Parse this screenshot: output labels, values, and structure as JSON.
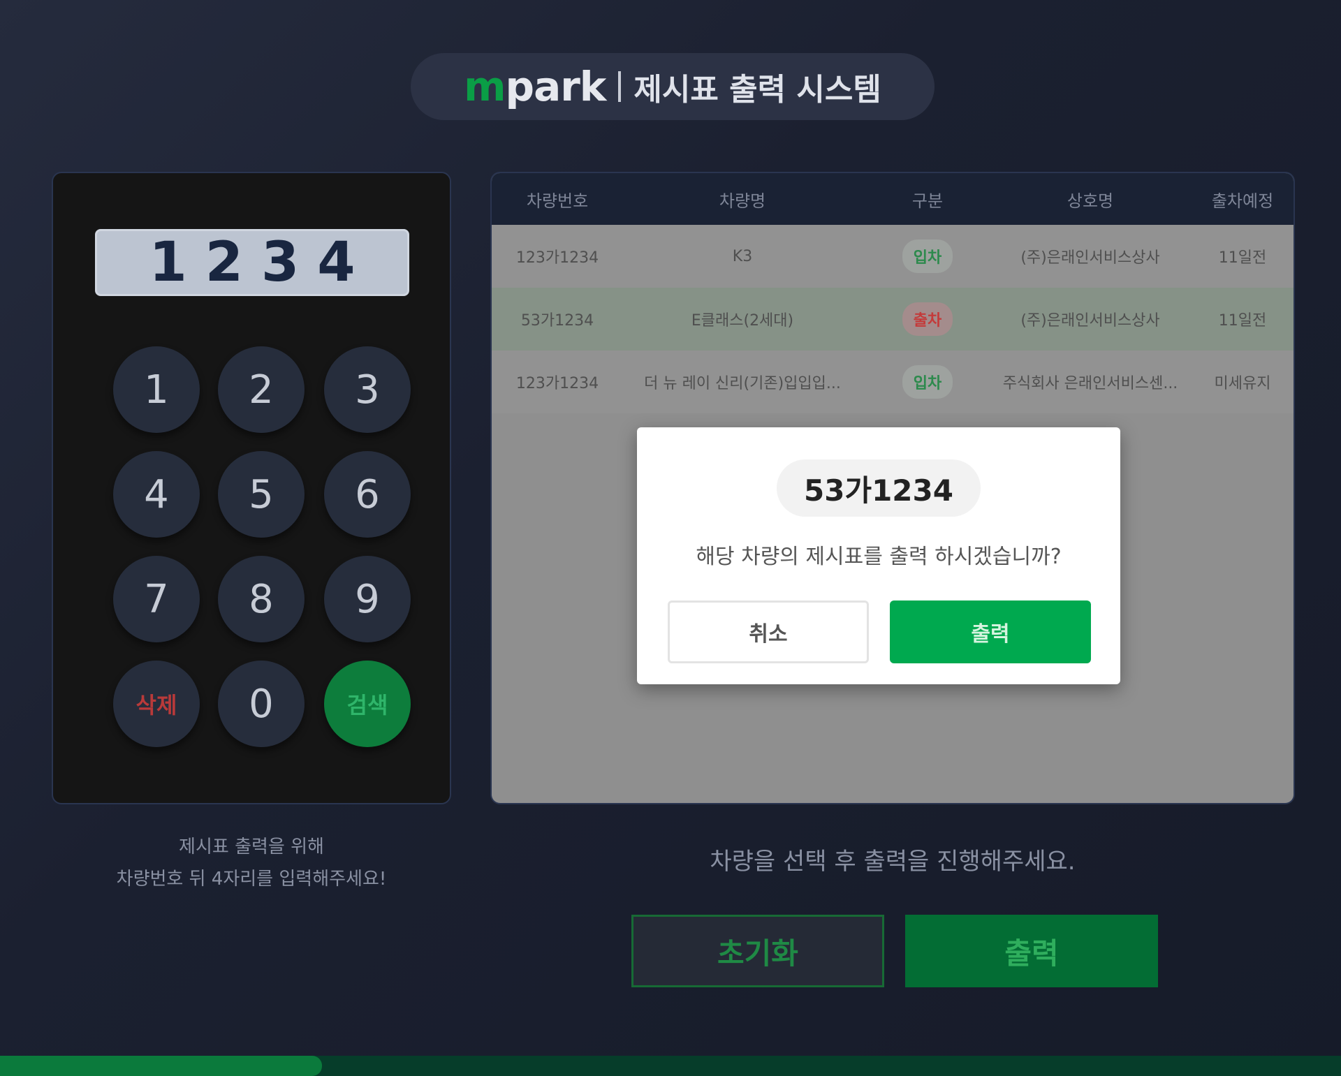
{
  "header": {
    "logo_m": "m",
    "logo_rest": "park",
    "title": "제시표 출력 시스템"
  },
  "keypad": {
    "display_value": "1234",
    "keys": [
      "1",
      "2",
      "3",
      "4",
      "5",
      "6",
      "7",
      "8",
      "9"
    ],
    "delete_label": "삭제",
    "zero_label": "0",
    "confirm_label": "검색"
  },
  "list": {
    "columns": [
      "차량번호",
      "차량명",
      "구분",
      "상호명",
      "출차예정"
    ],
    "rows": [
      {
        "plate": "123가1234",
        "car": "K3",
        "type": "입차",
        "company": "(주)은래인서비스상사",
        "due": "11일전"
      },
      {
        "plate": "53가1234",
        "car": "E클래스(2세대)",
        "type": "출차",
        "company": "(주)은래인서비스상사",
        "due": "11일전"
      },
      {
        "plate": "123가1234",
        "car": "더 뉴 레이 신리(기존)입입입...",
        "type": "입차",
        "company": "주식회사 은래인서비스센...",
        "due": "미세유지"
      }
    ]
  },
  "modal": {
    "plate": "53가1234",
    "message": "해당 차량의 제시표를 출력 하시겠습니까?",
    "cancel_label": "취소",
    "print_label": "출력"
  },
  "hints": {
    "left_line1": "제시표 출력을 위해",
    "left_line2": "차량번호 뒤 4자리를 입력해주세요!",
    "right": "차량을 선택 후 출력을 진행해주세요."
  },
  "actions": {
    "reset_label": "초기화",
    "print_label": "출력"
  },
  "progress": {
    "value_fraction": 0.24
  },
  "colors": {
    "accent_green": "#00a94f",
    "delete_red": "#b93a3a"
  }
}
